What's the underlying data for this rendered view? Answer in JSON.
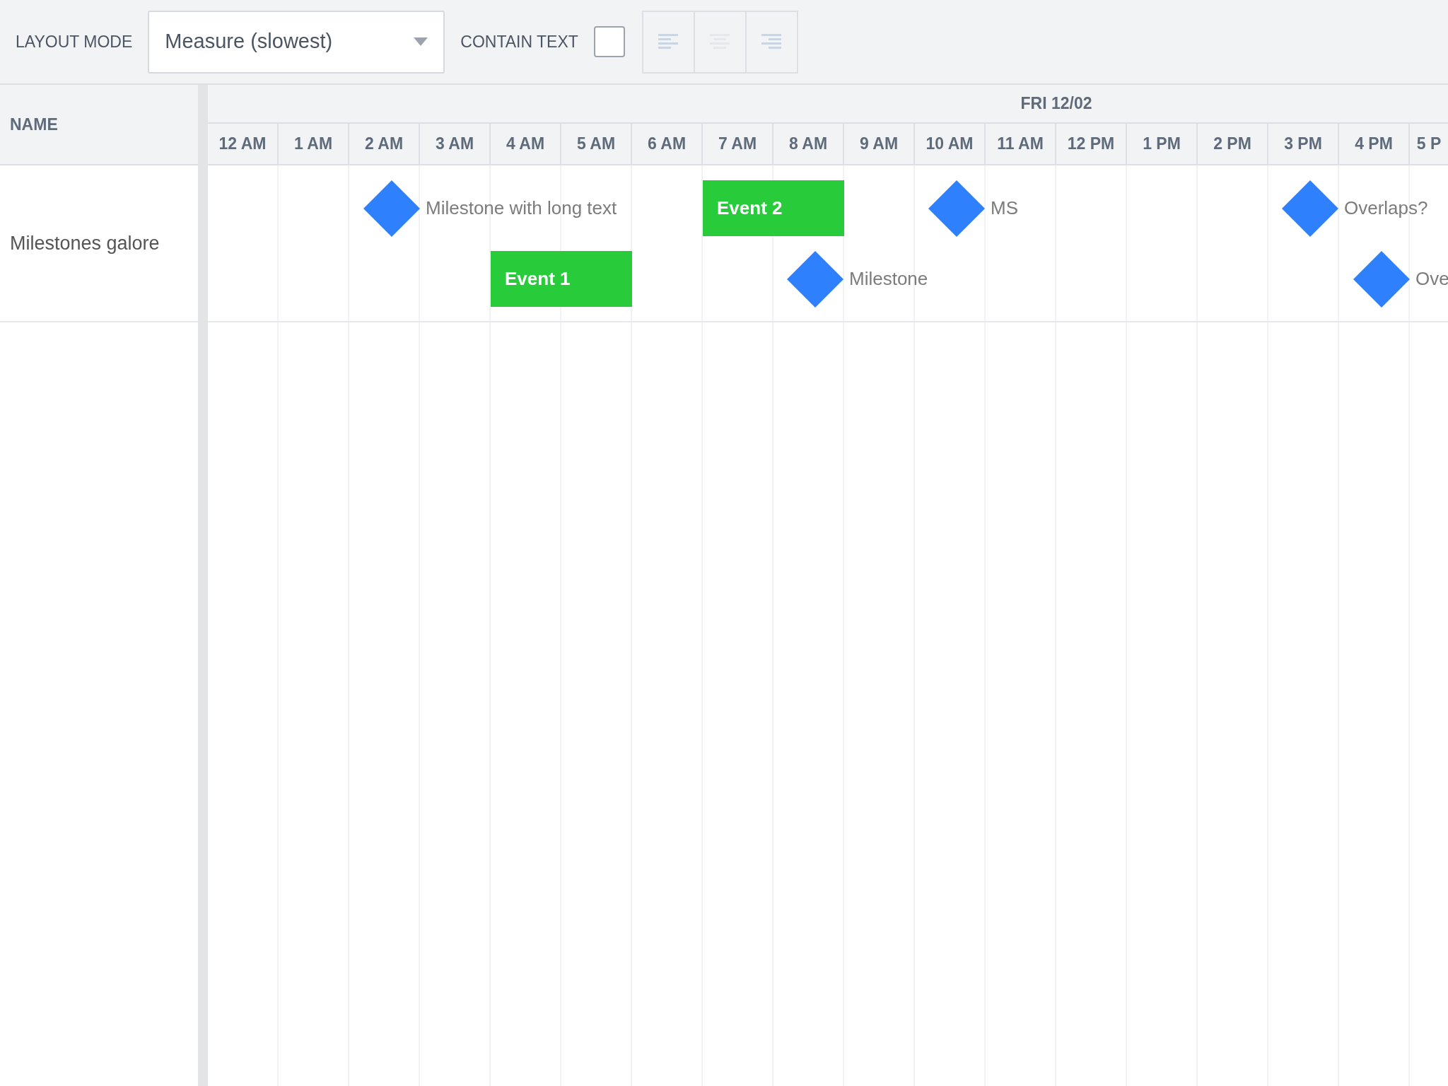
{
  "toolbar": {
    "layout_mode": {
      "label": "LAYOUT MODE",
      "value": "Measure (slowest)"
    },
    "contain_text": {
      "label": "CONTAIN TEXT",
      "checked": false
    },
    "align_buttons": [
      {
        "kind": "left"
      },
      {
        "kind": "center"
      },
      {
        "kind": "right"
      }
    ]
  },
  "columns": {
    "name_header": "NAME",
    "date": "FRI 12/02",
    "hours": [
      "12 AM",
      "1 AM",
      "2 AM",
      "3 AM",
      "4 AM",
      "5 AM",
      "6 AM",
      "7 AM",
      "8 AM",
      "9 AM",
      "10 AM",
      "11 AM",
      "12 PM",
      "1 PM",
      "2 PM",
      "3 PM",
      "4 PM",
      "5 P"
    ]
  },
  "rows": [
    {
      "name": "Milestones galore",
      "lanes": [
        [
          {
            "kind": "milestone",
            "label": "Milestone with long text"
          },
          {
            "kind": "event",
            "label": "Event 2"
          },
          {
            "kind": "milestone",
            "label": "MS"
          },
          {
            "kind": "milestone",
            "label": "Overlaps?"
          }
        ],
        [
          {
            "kind": "event",
            "label": "Event 1"
          },
          {
            "kind": "milestone",
            "label": "Milestone"
          },
          {
            "kind": "milestone",
            "label": "Ove"
          }
        ]
      ]
    }
  ]
}
